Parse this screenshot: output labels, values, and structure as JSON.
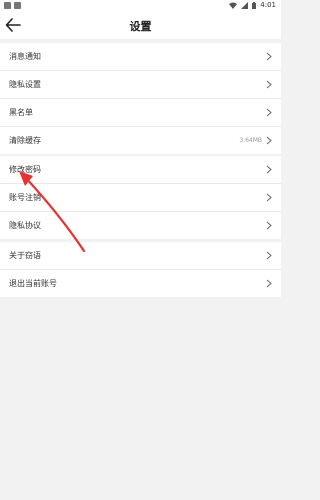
{
  "status_bar": {
    "time": "4:01"
  },
  "header": {
    "title": "设置"
  },
  "groups": [
    {
      "items": [
        {
          "label": "消息通知"
        },
        {
          "label": "隐私设置"
        },
        {
          "label": "黑名单"
        },
        {
          "label": "清除缓存",
          "value": "3.64MB"
        }
      ]
    },
    {
      "items": [
        {
          "label": "修改密码"
        },
        {
          "label": "账号注销"
        },
        {
          "label": "隐私协议"
        }
      ]
    },
    {
      "items": [
        {
          "label": "关于窃语"
        },
        {
          "label": "退出当前账号"
        }
      ]
    }
  ],
  "colors": {
    "annotation_arrow": "#e8322f",
    "background": "#f2f2f2"
  }
}
